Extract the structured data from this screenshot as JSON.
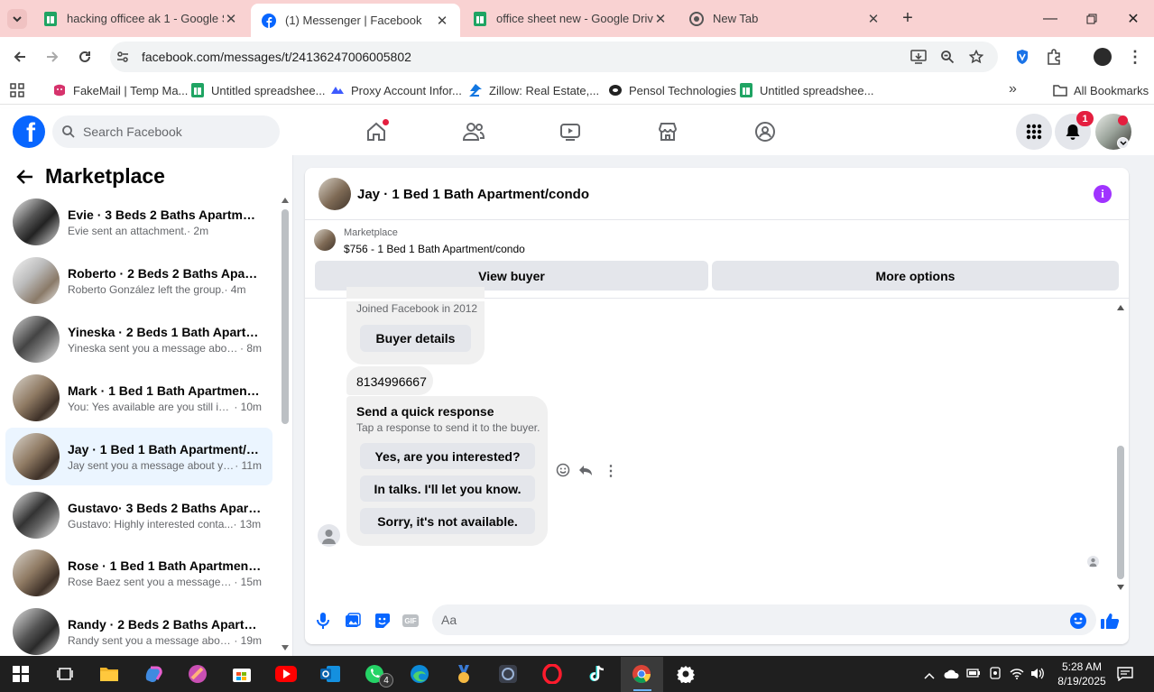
{
  "browser": {
    "tabs": [
      {
        "title": "hacking officee ak 1 - Google Sl",
        "icon": "sheets-icon"
      },
      {
        "title": "(1) Messenger | Facebook",
        "icon": "facebook-icon",
        "active": true
      },
      {
        "title": "office sheet new - Google Drive",
        "icon": "sheets-icon"
      },
      {
        "title": "New Tab",
        "icon": "chrome-icon"
      }
    ],
    "url": "facebook.com/messages/t/24136247006005802",
    "bookmarks": [
      "FakeMail | Temp Ma...",
      "Untitled spreadshee...",
      "Proxy Account Infor...",
      "Zillow: Real Estate,...",
      "Pensol Technologies",
      "Untitled spreadshee..."
    ],
    "all_bookmarks": "All Bookmarks"
  },
  "facebook": {
    "search_placeholder": "Search Facebook",
    "notification_count": "1"
  },
  "sidebar": {
    "title": "Marketplace",
    "conversations": [
      {
        "name": "Evie · 3 Beds 2 Baths Apartment...",
        "snippet": "Evie sent an attachment.",
        "time": "· 2m"
      },
      {
        "name": "Roberto · 2 Beds 2 Baths Apart...",
        "snippet": "Roberto González left the group.",
        "time": "· 4m"
      },
      {
        "name": "Yineska · 2 Beds 1 Bath Apartme...",
        "snippet": "Yineska sent you a message about...",
        "time": "· 8m"
      },
      {
        "name": "Mark · 1 Bed 1 Bath Apartment/...",
        "snippet": "You: Yes available are you still int...",
        "time": "· 10m"
      },
      {
        "name": "Jay · 1 Bed 1 Bath Apartment/co...",
        "snippet": "Jay sent you a message about yo...",
        "time": "· 11m",
        "selected": true
      },
      {
        "name": "Gustavo· 3 Beds 2 Baths Apartm...",
        "snippet": "Gustavo: Highly interested conta...",
        "time": "· 13m"
      },
      {
        "name": "Rose · 1 Bed 1 Bath Apartment/c...",
        "snippet": "Rose Baez sent you a message a...",
        "time": "· 15m"
      },
      {
        "name": "Randy · 2 Beds 2 Baths Apartme...",
        "snippet": "Randy sent you a message about...",
        "time": "· 19m"
      }
    ]
  },
  "chat": {
    "title": "Jay · 1 Bed 1 Bath Apartment/condo",
    "listing_source": "Marketplace",
    "listing": "$756 - 1 Bed 1 Bath Apartment/condo",
    "view_buyer": "View buyer",
    "more_options": "More options",
    "joined": "Joined Facebook in 2012",
    "buyer_details": "Buyer details",
    "phone": "8134996667",
    "quick_title": "Send a quick response",
    "quick_sub": "Tap a response to send it to the buyer.",
    "quick_responses": [
      "Yes, are you interested?",
      "In talks. I'll let you know.",
      "Sorry, it's not available."
    ],
    "composer_placeholder": "Aa"
  },
  "taskbar": {
    "time": "5:28 AM",
    "date": "8/19/2025",
    "whatsapp_badge": "4"
  },
  "colors": {
    "fb_blue": "#0866ff",
    "tabstrip": "#f9d2d2",
    "selected_row": "#ebf5ff",
    "info": "#a033ff"
  }
}
